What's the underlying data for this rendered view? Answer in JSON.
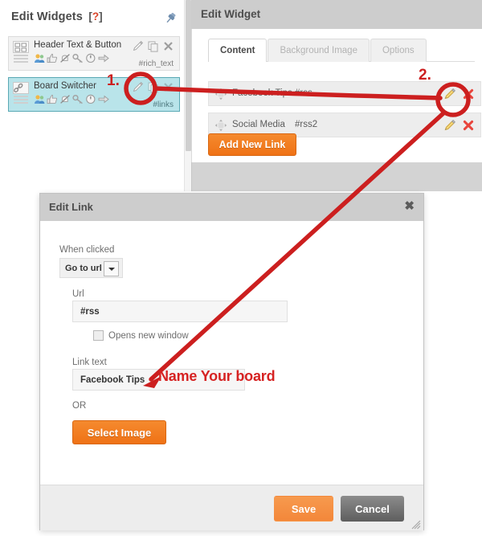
{
  "widgets_panel": {
    "title": "Edit Widgets",
    "help_label": "[?]",
    "help_bracket_open": "[",
    "help_mark": "?",
    "help_bracket_close": "]",
    "pin_icon": "pushpin-icon",
    "items": [
      {
        "name": "Header Text & Button",
        "tag": "#rich_text",
        "selected": false,
        "thumb_icon": "widget-grid-thumb-icon",
        "social_icons": [
          "users-icon",
          "thumbs-up-icon",
          "mute-bell-icon",
          "key-icon",
          "power-icon",
          "arrow-right-icon"
        ],
        "actions": [
          "pencil-edit-icon",
          "duplicate-icon",
          "close-x-icon"
        ]
      },
      {
        "name": "Board Switcher",
        "tag": "#links",
        "selected": true,
        "thumb_icon": "widget-link-thumb-icon",
        "social_icons": [
          "users-icon",
          "thumbs-up-icon",
          "mute-bell-icon",
          "key-icon",
          "power-icon",
          "arrow-right-icon"
        ],
        "actions": [
          "pencil-edit-icon",
          "duplicate-icon",
          "close-x-icon"
        ]
      }
    ]
  },
  "edit_widget": {
    "title": "Edit Widget",
    "tabs": [
      {
        "label": "Content",
        "active": true
      },
      {
        "label": "Background Image",
        "active": false
      },
      {
        "label": "Options",
        "active": false
      }
    ],
    "links": [
      {
        "text": "Facebook Tips",
        "url": "#rss",
        "drag_icon": "move-4way-icon",
        "edit_icon": "pencil-edit-icon",
        "delete_icon": "delete-x-icon"
      },
      {
        "text": "Social Media",
        "url": "#rss2",
        "drag_icon": "move-4way-icon",
        "edit_icon": "pencil-edit-icon",
        "delete_icon": "delete-x-icon"
      }
    ],
    "add_link_label": "Add New Link"
  },
  "edit_link": {
    "title": "Edit Link",
    "close_glyph": "✖",
    "when_clicked_label": "When clicked",
    "when_clicked_value": "Go to url",
    "when_clicked_options": [
      "Go to url"
    ],
    "url_label": "Url",
    "url_value": "#rss",
    "url_placeholder": "",
    "opens_new_window_label": "Opens new window",
    "opens_new_window_checked": false,
    "link_text_label": "Link text",
    "link_text_value": "Facebook Tips",
    "link_text_placeholder": "",
    "or_label": "OR",
    "select_image_label": "Select Image",
    "save_label": "Save",
    "cancel_label": "Cancel",
    "resize_grip_icon": "resize-grip-icon"
  },
  "annotations": {
    "step_one": "1.",
    "step_two": "2.",
    "callout_text": "Name Your board",
    "color": "#d62222"
  },
  "colors": {
    "accent_orange": "#ef7216",
    "selected_row": "#b9e4ea",
    "header_gray": "#cdcdcd",
    "annotation_red": "#d62222",
    "delete_red": "#e8453c"
  }
}
